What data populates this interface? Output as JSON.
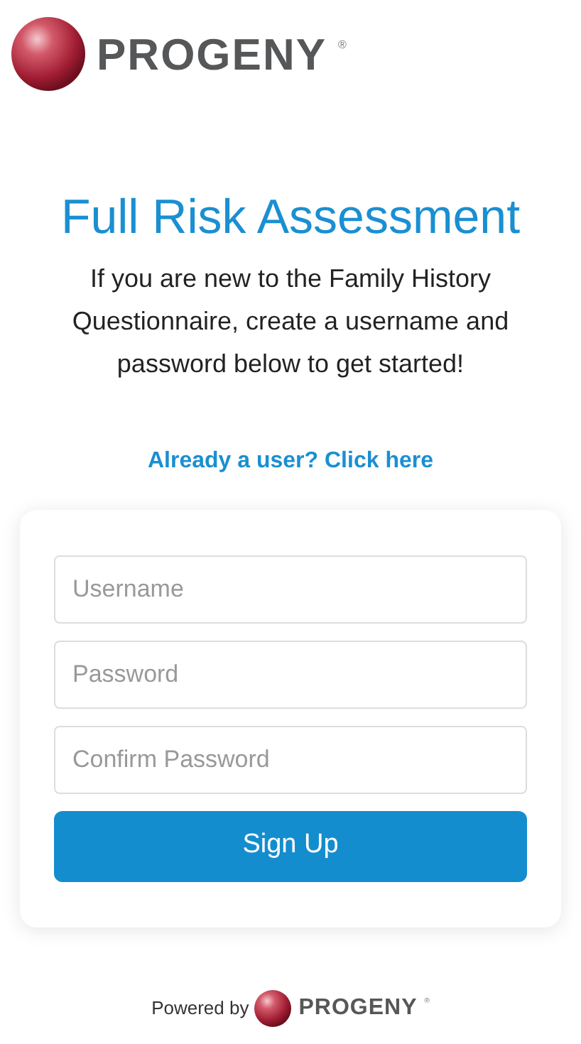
{
  "header": {
    "logo": {
      "name": "PROGENY",
      "mark": "®"
    }
  },
  "title": "Full Risk Assessment",
  "intro": "If you are new to the Family History Questionnaire, create a username and password below to get started!",
  "login_link": "Already a user? Click here",
  "form": {
    "fields": [
      {
        "placeholder": "Username"
      },
      {
        "placeholder": "Password"
      },
      {
        "placeholder": "Confirm Password"
      }
    ],
    "submit": "Sign Up"
  },
  "footer": {
    "label": "Powered by",
    "logo": {
      "name": "PROGENY",
      "mark": "®"
    }
  }
}
